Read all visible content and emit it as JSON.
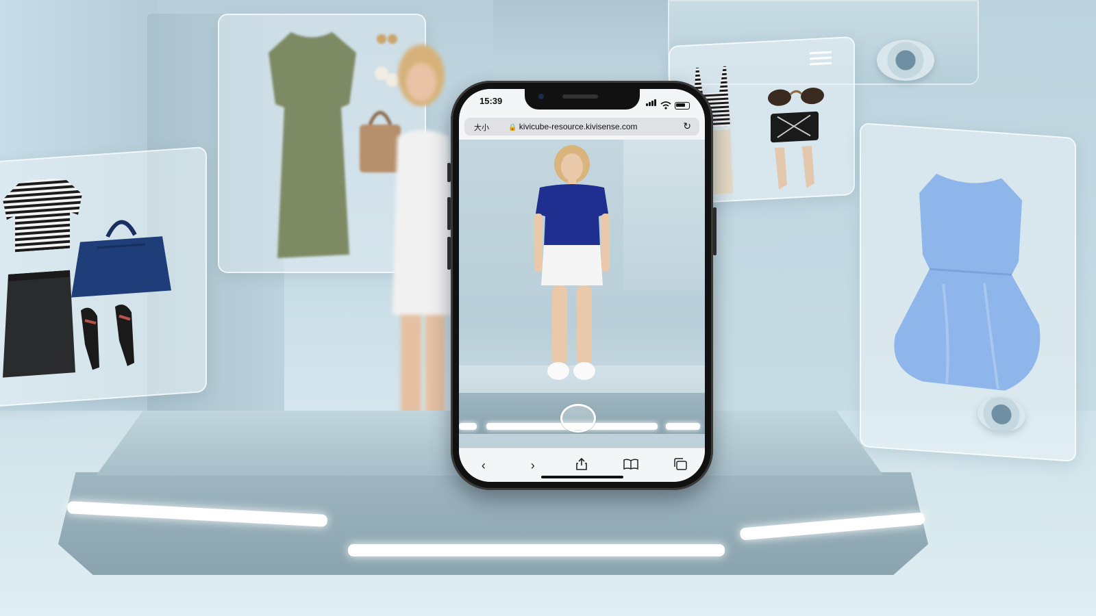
{
  "phone": {
    "status_time": "15:39",
    "browser": {
      "text_size_label": "大小",
      "url": "kivicube-resource.kivisense.com",
      "reload_icon": "reload-icon"
    },
    "toolbar": {
      "back_icon": "chevron-left-icon",
      "forward_icon": "chevron-right-icon",
      "share_icon": "share-icon",
      "bookmarks_icon": "book-icon",
      "tabs_icon": "tabs-icon"
    }
  },
  "colors": {
    "blue_top": "#1f2f8f",
    "light_blue_dress": "#8fb6ea",
    "olive_dress": "#7d8a64",
    "navy_bag": "#1f3d78"
  }
}
